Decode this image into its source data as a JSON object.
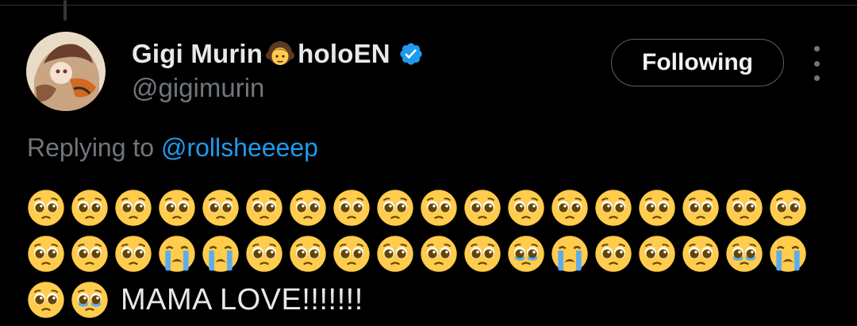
{
  "author": {
    "display_name": "Gigi Murin",
    "name_suffix": "holoEN",
    "handle": "@gigimurin",
    "verified": true,
    "name_emoji": "girl-emoji"
  },
  "actions": {
    "follow_label": "Following",
    "more_icon": "more-dots-icon"
  },
  "reply": {
    "prefix": "Replying to",
    "mention": "@rollsheeeep"
  },
  "tweet": {
    "emoji_rows": [
      [
        "pleading",
        "pleading",
        "pleading",
        "pleading",
        "pleading",
        "pleading",
        "pleading",
        "pleading",
        "pleading",
        "pleading",
        "pleading",
        "pleading",
        "pleading",
        "pleading",
        "pleading",
        "pleading",
        "pleading",
        "pleading"
      ],
      [
        "pleading",
        "pleading",
        "pleading",
        "crying",
        "crying",
        "pleading",
        "pleading",
        "pleading",
        "pleading",
        "pleading",
        "pleading",
        "holding-tears",
        "crying",
        "pleading",
        "pleading",
        "pleading",
        "holding-tears",
        "crying"
      ],
      [
        "pleading",
        "holding-tears"
      ]
    ],
    "text": "MAMA LOVE!!!!!!!"
  },
  "colors": {
    "background": "#000000",
    "text": "#e7e9ea",
    "muted": "#71767b",
    "accent": "#1d9bf0",
    "border": "#536471"
  }
}
